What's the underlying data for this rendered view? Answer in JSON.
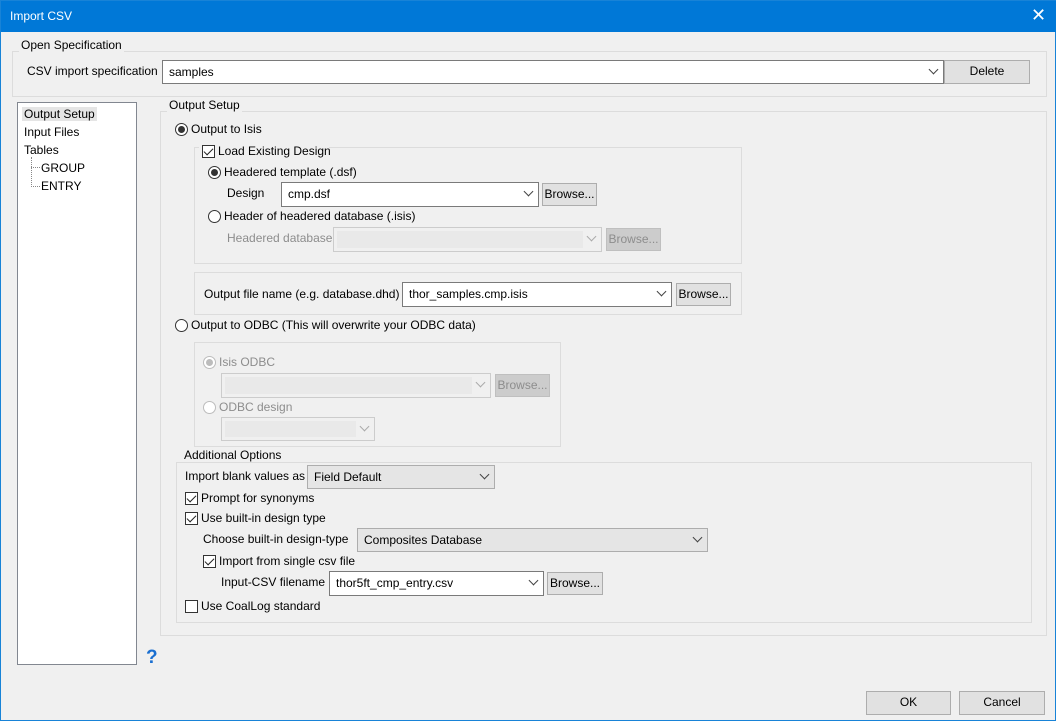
{
  "window": {
    "title": "Import CSV",
    "close": "✕"
  },
  "open_spec": {
    "legend": "Open Specification",
    "label": "CSV import specification",
    "value": "samples",
    "delete": "Delete"
  },
  "tree": {
    "items": [
      "Output Setup",
      "Input Files",
      "Tables"
    ],
    "children": [
      "GROUP",
      "ENTRY"
    ]
  },
  "output_setup": {
    "legend": "Output Setup",
    "output_isis": "Output to Isis",
    "load_existing": "Load Existing Design",
    "headered_template": "Headered template (.dsf)",
    "design_label": "Design",
    "design_value": "cmp.dsf",
    "header_db": "Header of headered database (.isis)",
    "headered_db_label": "Headered database",
    "browse": "Browse...",
    "output_file_label": "Output file name (e.g. database.dhd)",
    "output_file_value": "thor_samples.cmp.isis",
    "output_odbc": "Output to ODBC (This will overwrite your ODBC data)",
    "isis_odbc": "Isis ODBC",
    "odbc_design": "ODBC design"
  },
  "additional": {
    "legend": "Additional Options",
    "blank_label": "Import blank values as",
    "blank_value": "Field Default",
    "prompt_synonyms": "Prompt for synonyms",
    "use_builtin": "Use built-in design type",
    "choose_label": "Choose built-in design-type",
    "choose_value": "Composites Database",
    "single_csv": "Import from single csv file",
    "input_csv_label": "Input-CSV filename",
    "input_csv_value": "thor5ft_cmp_entry.csv",
    "coallog": "Use CoalLog standard"
  },
  "help": "?",
  "buttons": {
    "ok": "OK",
    "cancel": "Cancel"
  }
}
